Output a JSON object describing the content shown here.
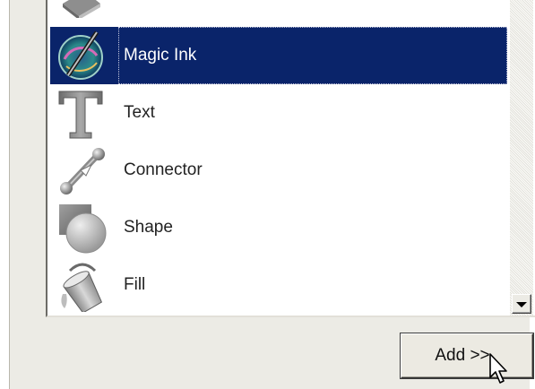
{
  "tool_list": {
    "items": [
      {
        "label": "",
        "icon": "eraser-icon"
      },
      {
        "label": "Magic Ink",
        "icon": "magic-ink-icon",
        "selected": true
      },
      {
        "label": "Text",
        "icon": "text-icon"
      },
      {
        "label": "Connector",
        "icon": "connector-icon"
      },
      {
        "label": "Shape",
        "icon": "shape-icon"
      },
      {
        "label": "Fill",
        "icon": "fill-bucket-icon"
      }
    ]
  },
  "buttons": {
    "add_label": "Add >>"
  },
  "colors": {
    "selection": "#0a246a",
    "panel_bg": "#ecebe5",
    "list_bg": "#ffffff"
  }
}
